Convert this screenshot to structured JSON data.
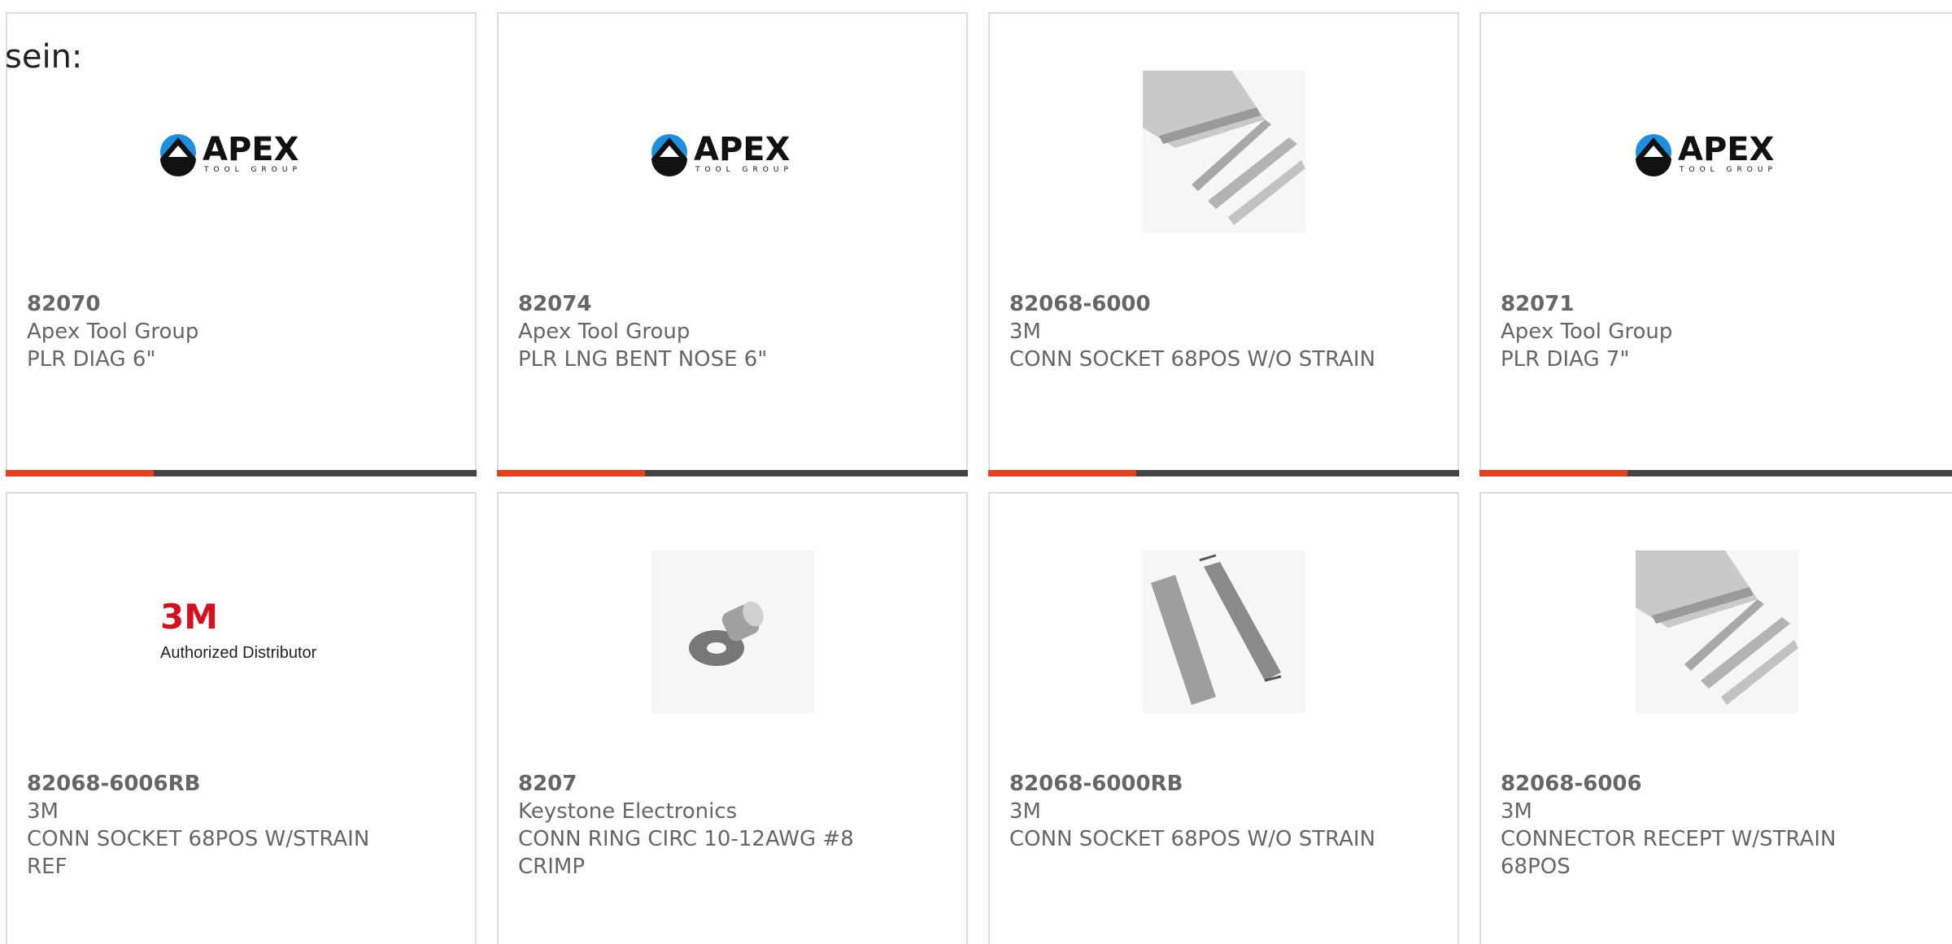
{
  "intro": {
    "text": "sein:"
  },
  "colors": {
    "accent": "#e8401c",
    "bar": "#444444",
    "text": "#666666",
    "border": "#dcdcdc"
  },
  "products": [
    {
      "part_number": "82070",
      "manufacturer": "Apex Tool Group",
      "description": "PLR DIAG 6\"",
      "image": "apex-tool-group-logo"
    },
    {
      "part_number": "82074",
      "manufacturer": "Apex Tool Group",
      "description": "PLR LNG BENT NOSE 6\"",
      "image": "apex-tool-group-logo"
    },
    {
      "part_number": "82068-6000",
      "manufacturer": "3M",
      "description": "CONN SOCKET 68POS W/O STRAIN",
      "image": "ribbon-cable-connector-photo"
    },
    {
      "part_number": "82071",
      "manufacturer": "Apex Tool Group",
      "description": "PLR DIAG 7\"",
      "image": "apex-tool-group-logo"
    },
    {
      "part_number": "82068-6006RB",
      "manufacturer": "3M",
      "description": "CONN SOCKET 68POS W/STRAIN REF",
      "image": "3m-authorized-distributor-logo"
    },
    {
      "part_number": "8207",
      "manufacturer": "Keystone Electronics",
      "description": "CONN RING CIRC 10-12AWG #8 CRIMP",
      "image": "ring-terminal-photo"
    },
    {
      "part_number": "82068-6000RB",
      "manufacturer": "3M",
      "description": "CONN SOCKET 68POS W/O STRAIN",
      "image": "socket-connector-photo"
    },
    {
      "part_number": "82068-6006",
      "manufacturer": "3M",
      "description": "CONNECTOR RECEPT W/STRAIN 68POS",
      "image": "ribbon-cable-connector-photo"
    }
  ],
  "logos": {
    "apex_name": "APEX",
    "apex_sub": "TOOL GROUP",
    "threem_name": "3M",
    "threem_sub": "Authorized Distributor"
  }
}
